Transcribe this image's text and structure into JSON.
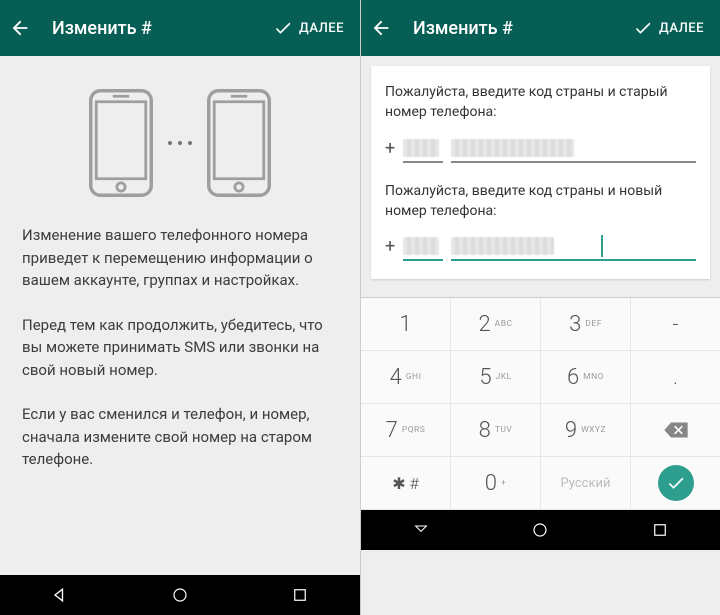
{
  "appbar": {
    "title": "Изменить #",
    "next": "ДАЛЕЕ"
  },
  "intro": {
    "p1": "Изменение вашего телефонного номера приведет к перемещению информации о вашем аккаунте, группах и настройках.",
    "p2": "Перед тем как продолжить, убедитесь, что вы можете принимать SMS или звонки на свой новый номер.",
    "p3": "Если у вас сменился и телефон, и номер, сначала измените свой номер на старом телефоне."
  },
  "form": {
    "old_label": "Пожалуйста, введите код страны и старый номер телефона:",
    "new_label": "Пожалуйста, введите код страны и новый номер телефона:",
    "plus": "+"
  },
  "keypad": {
    "rows": [
      [
        {
          "d": "1",
          "s": ""
        },
        {
          "d": "2",
          "s": "ABC"
        },
        {
          "d": "3",
          "s": "DEF"
        },
        {
          "d": "-",
          "s": ""
        }
      ],
      [
        {
          "d": "4",
          "s": "GHI"
        },
        {
          "d": "5",
          "s": "JKL"
        },
        {
          "d": "6",
          "s": "MNO"
        },
        {
          "d": ".",
          "s": ""
        }
      ],
      [
        {
          "d": "7",
          "s": "PQRS"
        },
        {
          "d": "8",
          "s": "TUV"
        },
        {
          "d": "9",
          "s": "WXYZ"
        },
        {
          "d": "⌫",
          "s": ""
        }
      ],
      [
        {
          "d": "*  #",
          "s": ""
        },
        {
          "d": "0",
          "s": "+"
        },
        {
          "d": "Русский",
          "s": ""
        },
        {
          "d": "go",
          "s": ""
        }
      ]
    ],
    "k1": "1",
    "k2": "2",
    "k2s": "ABC",
    "k3": "3",
    "k3s": "DEF",
    "dash": "-",
    "k4": "4",
    "k4s": "GHI",
    "k5": "5",
    "k5s": "JKL",
    "k6": "6",
    "k6s": "MNO",
    "dot": ".",
    "k7": "7",
    "k7s": "PQRS",
    "k8": "8",
    "k8s": "TUV",
    "k9": "9",
    "k9s": "WXYZ",
    "starhash": "✱  #",
    "k0": "0",
    "k0s": "+",
    "lang": "Русский"
  }
}
